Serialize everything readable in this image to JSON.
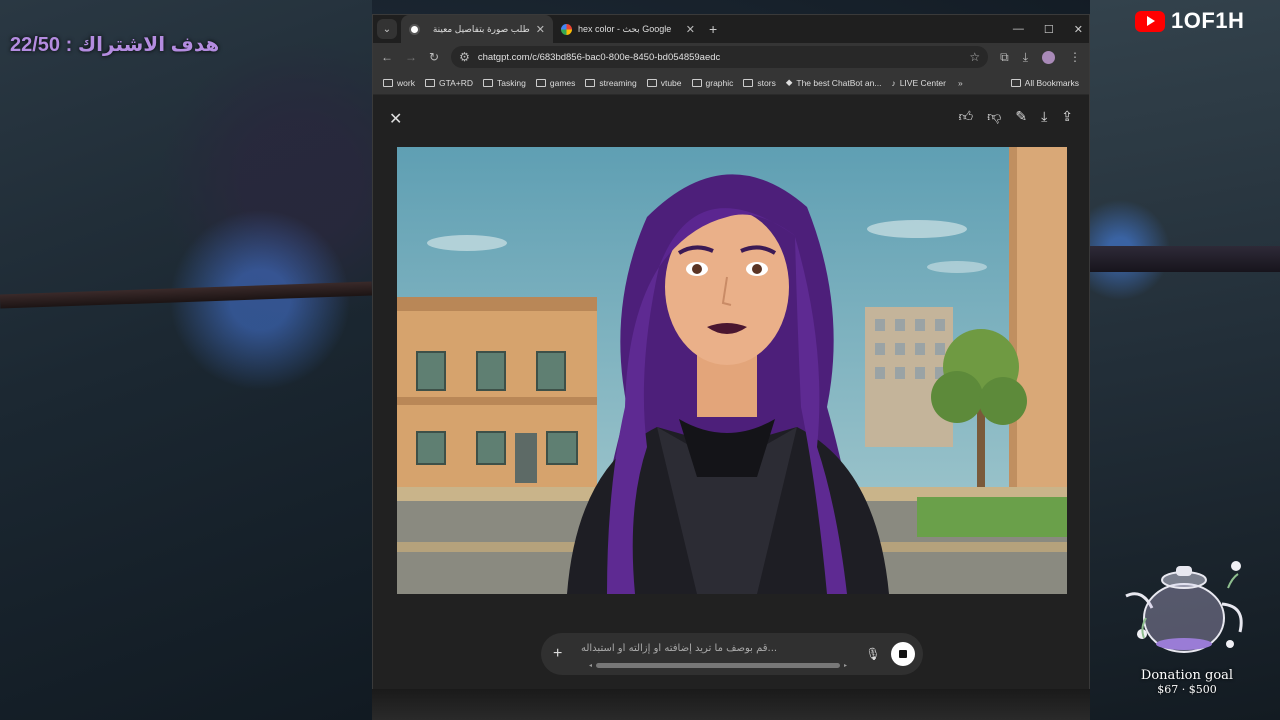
{
  "overlay": {
    "subscriber_goal": "هدف الاشتراك : 22/50",
    "channel_name": "1OF1H",
    "donation_label": "Donation goal",
    "donation_amount": "$67 · $500"
  },
  "browser": {
    "tabs": [
      {
        "title": "طلب صورة بتفاصيل معينة",
        "active": true,
        "favicon": "chatgpt-icon"
      },
      {
        "title": "hex color - بحث Google",
        "active": false,
        "favicon": "google-icon"
      }
    ],
    "url": "chatgpt.com/c/683bd856-bac0-800e-8450-bd054859aedc",
    "bookmarks": [
      {
        "label": "work",
        "type": "folder"
      },
      {
        "label": "GTA+RD",
        "type": "folder"
      },
      {
        "label": "Tasking",
        "type": "folder"
      },
      {
        "label": "games",
        "type": "folder"
      },
      {
        "label": "streaming",
        "type": "folder"
      },
      {
        "label": "vtube",
        "type": "folder"
      },
      {
        "label": "graphic",
        "type": "folder"
      },
      {
        "label": "stors",
        "type": "folder"
      },
      {
        "label": "The best ChatBot an...",
        "type": "link"
      },
      {
        "label": "LIVE Center",
        "type": "link"
      }
    ],
    "all_bookmarks": "All Bookmarks"
  },
  "composer": {
    "placeholder": "...قم بوصف ما تريد إضافته أو إزالته أو استبداله"
  },
  "colors": {
    "accent_purple": "#b48ce0",
    "youtube_red": "#ff0000",
    "browser_bg": "#212121"
  }
}
